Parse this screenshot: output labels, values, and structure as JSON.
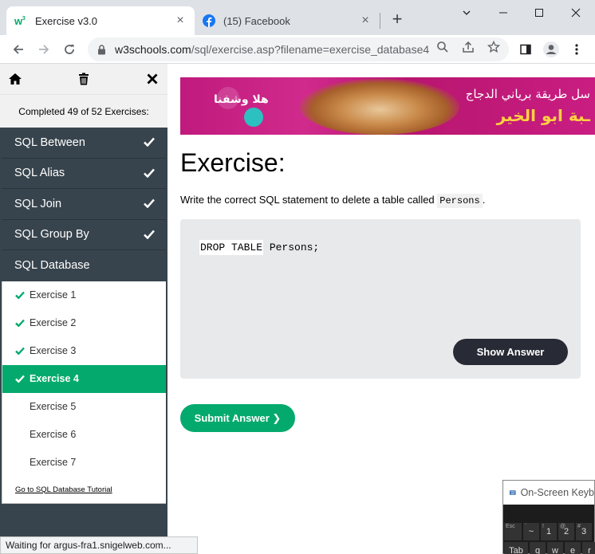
{
  "browser": {
    "tabs": [
      {
        "title": "Exercise v3.0",
        "icon": "w3schools-icon",
        "active": true
      },
      {
        "title": "(15) Facebook",
        "icon": "facebook-icon",
        "active": false
      }
    ],
    "url_host": "w3schools.com",
    "url_path": "/sql/exercise.asp?filename=exercise_database4"
  },
  "sidebar": {
    "progress": "Completed 49 of 52 Exercises:",
    "categories": [
      {
        "label": "SQL Between",
        "done": true
      },
      {
        "label": "SQL Alias",
        "done": true
      },
      {
        "label": "SQL Join",
        "done": true
      },
      {
        "label": "SQL Group By",
        "done": true
      },
      {
        "label": "SQL Database",
        "done": false
      }
    ],
    "exercises": [
      {
        "label": "Exercise 1",
        "done": true
      },
      {
        "label": "Exercise 2",
        "done": true
      },
      {
        "label": "Exercise 3",
        "done": true
      },
      {
        "label": "Exercise 4",
        "done": true,
        "active": true
      },
      {
        "label": "Exercise 5",
        "done": false
      },
      {
        "label": "Exercise 6",
        "done": false
      },
      {
        "label": "Exercise 7",
        "done": false
      }
    ],
    "tutorial_link": "Go to SQL Database Tutorial"
  },
  "ad": {
    "line1": "سل طريقة برياني الدجاج",
    "line2": "ـبة ابو الخير",
    "logo_text": "هلا وشفنا"
  },
  "exercise": {
    "title": "Exercise:",
    "desc_before": "Write the correct SQL statement to delete a table called ",
    "desc_code": "Persons",
    "desc_after": ".",
    "answer_filled": "DROP TABLE",
    "answer_rest": " Persons;",
    "show_answer": "Show Answer",
    "submit": "Submit Answer ❯"
  },
  "status": "Waiting for argus-fra1.snigelweb.com...",
  "osk": {
    "title": "On-Screen Keyb",
    "row1": [
      {
        "main": "",
        "small": "Esc"
      },
      {
        "main": "~",
        "small": "`"
      },
      {
        "main": "1",
        "small": "!"
      },
      {
        "main": "2",
        "small": "@"
      },
      {
        "main": "3",
        "small": "#"
      }
    ],
    "row2": [
      "Tab",
      "q",
      "w",
      "e",
      "r"
    ]
  },
  "colors": {
    "accent": "#04aa6d",
    "sidebar_bg": "#38444d",
    "dark_button": "#282a35"
  }
}
